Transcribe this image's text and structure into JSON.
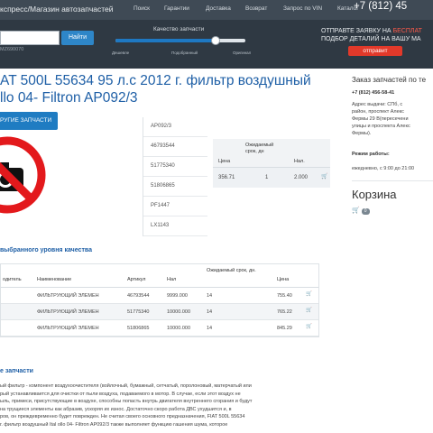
{
  "topbar": {
    "brand": "кспресс/Магазин автозапчастей",
    "nav": [
      "Поиск",
      "Гарантии",
      "Доставка",
      "Возврат",
      "Запрос по VIN",
      "Каталог"
    ],
    "phone": "+7 (812) 45"
  },
  "search": {
    "placeholder": "",
    "button": "Найти",
    "hint": "MZ690070"
  },
  "quality": {
    "title": "Качество запчасти",
    "level_fraction": 0.77,
    "labels": [
      "Дешевле",
      "Подобранный",
      "Оригинал"
    ],
    "accent": "#1e78c2"
  },
  "promo": {
    "line1_a": "ОТПРАВТЕ ЗАЯВКУ НА ",
    "line1_b": "БЕСПЛАТ",
    "line2": "ПОДБОР ДЕТАЛИЙ НА ВАШУ МА",
    "button": "отправит",
    "accent": "#e2392a"
  },
  "product": {
    "title_line1": "AT 500L 55634 95 л.с 2012 г. фильтр воздушный",
    "title_line2": "llo 04- Filtron AP092/3",
    "other_button": "РУГИЕ ЗАПЧАСТИ",
    "image_icon": "no-photo-icon",
    "articles": [
      "AP092/3",
      "46793544",
      "51775340",
      "51806865",
      "PF1447",
      "LX1143"
    ]
  },
  "price_table": {
    "headers": [
      "Цена",
      "Ожидаемый срок, дн",
      "Нал."
    ],
    "row": {
      "price": "356.71",
      "days": "1",
      "stock": "2.000"
    }
  },
  "sidebar": {
    "title": "Заказ запчастей по те",
    "phone": "+7 (812) 456-58-41",
    "address_label": "Адрес выдачи:",
    "address_lines": [
      "Адрес выдачи: СПб, с",
      "район, проспект Алекс",
      "Фермы 29 В(пересечени",
      "улицы и проспекта Алекс",
      "Фермы)."
    ],
    "hours_label": "Режим работы:",
    "hours": "ежедневно, с 9:00 до 21:00",
    "basket_title": "Корзина",
    "basket_count": "0"
  },
  "quality_section": {
    "title": "выбранного уровня качества",
    "headers": [
      "одитель",
      "Наименование",
      "Артикул",
      "Нал",
      "Ожидаемый срок, дн.",
      "Цена"
    ],
    "rows": [
      {
        "maker": "",
        "name": "ФИЛЬТРУЮЩИЙ ЭЛЕМЕН",
        "article": "46793544",
        "stock": "9999.000",
        "days": "14",
        "price": "755.40"
      },
      {
        "maker": "",
        "name": "ФИЛЬТРУЮЩИЙ ЭЛЕМЕН",
        "article": "51775340",
        "stock": "10000.000",
        "days": "14",
        "price": "765.22"
      },
      {
        "maker": "",
        "name": "ФИЛЬТРУЮЩИЙ ЭЛЕМЕН",
        "article": "51806865",
        "stock": "10000.000",
        "days": "14",
        "price": "845.29"
      }
    ]
  },
  "description": {
    "title": "е запчасти",
    "lines": [
      "ый фильтр - компонент воздухоочистителя (войлочный, бумажный, сетчатый, поролоновый, матерчатый или",
      "рый устанавливается для очистки от пыли воздуха, подаваемого в мотор. В случае, если этот воздух не",
      "ыль, примеси, присутствующие в воздухе, способны попасть внутрь двигателя внутреннего сгорания и будут",
      "на трущиеся элементы как абразив, ускоряя их износ. Достаточно скоро работа ДВС ухудшится и, в",
      "ров, он преждевременно будет поврежден. Не считая своего основного предназначения, FIAT 500L 55634",
      "г. фильтр воздушный Ital ollo 04- Filtron AP092/3 также выполняет функцию гашения шума, которое"
    ]
  }
}
